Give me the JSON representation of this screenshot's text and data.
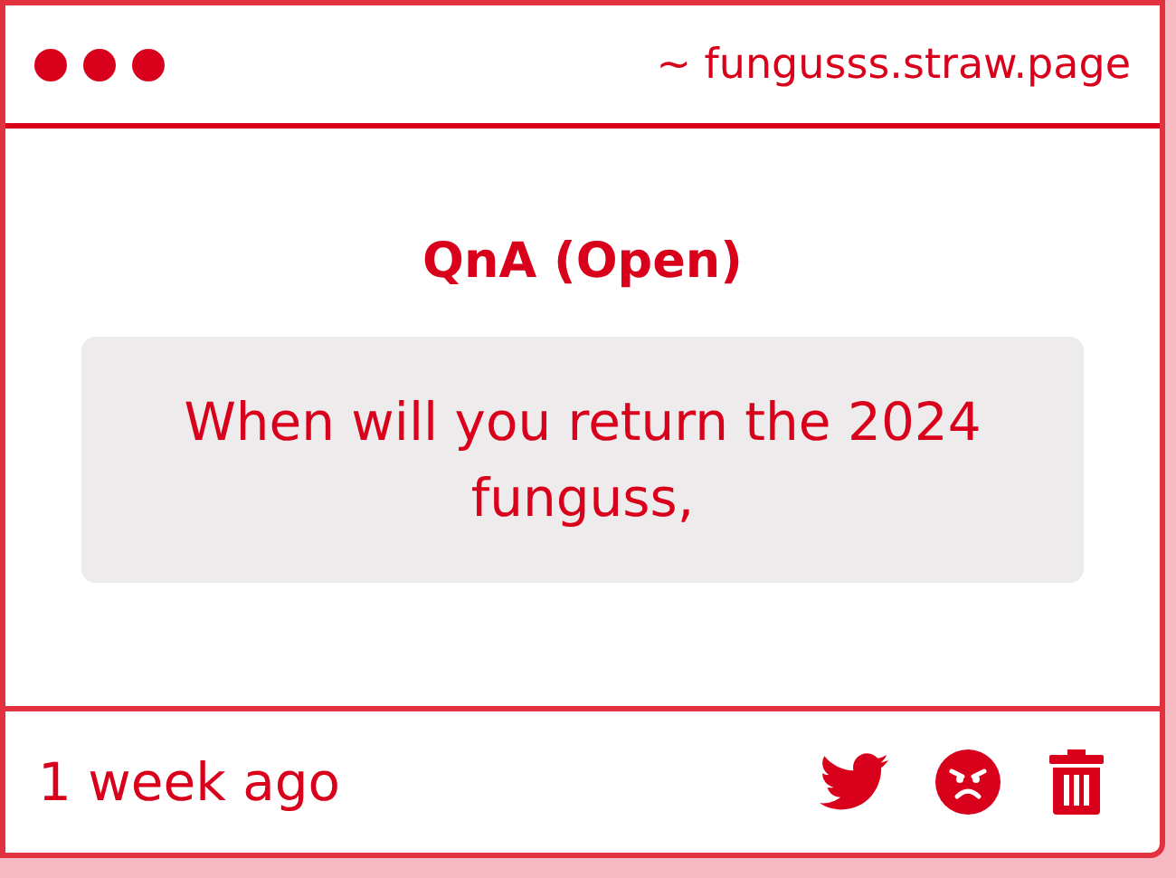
{
  "header": {
    "url": "~ fungusss.straw.page"
  },
  "question": {
    "title": "QnA (Open)",
    "text": "When will you return the 2024 funguss,"
  },
  "footer": {
    "time": "1 week ago"
  }
}
